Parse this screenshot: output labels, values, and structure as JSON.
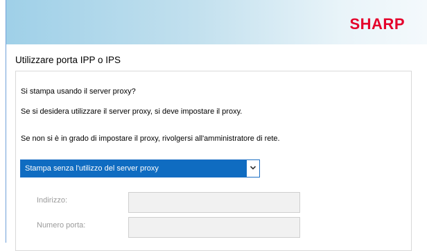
{
  "brand": {
    "logo_text": "SHARP",
    "logo_color": "#e4002b",
    "accent": "#0f6cc1"
  },
  "page": {
    "title": "Utilizzare porta IPP o IPS"
  },
  "content": {
    "question": "Si stampa usando il server proxy?",
    "info1": "Se si desidera utilizzare il server proxy, si deve impostare il proxy.",
    "info2": "Se non si è in grado di impostare il proxy, rivolgersi all'amministratore di rete."
  },
  "proxy_select": {
    "value": "Stampa senza l'utilizzo del server proxy",
    "icon": "chevron-down-icon"
  },
  "fields": {
    "address_label": "Indirizzo:",
    "address_value": "",
    "port_label": "Numero porta:",
    "port_value": ""
  }
}
